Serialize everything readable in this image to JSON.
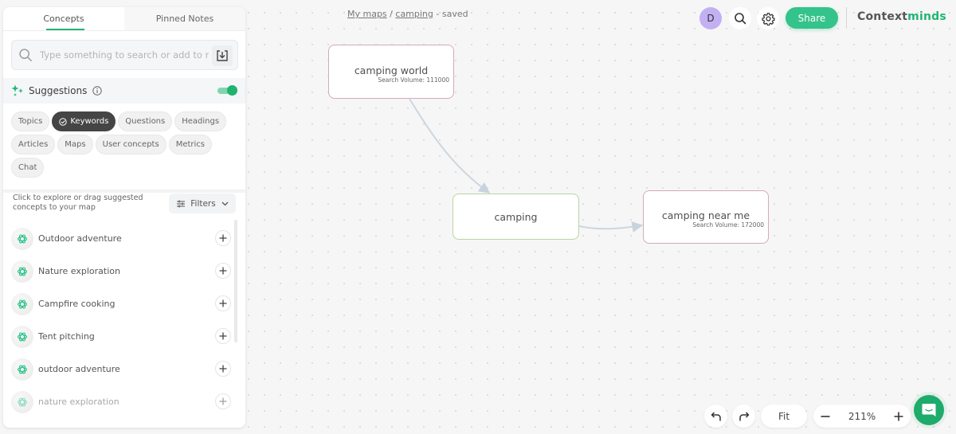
{
  "sidebar": {
    "tabs": [
      {
        "label": "Concepts",
        "active": true
      },
      {
        "label": "Pinned Notes",
        "active": false
      }
    ],
    "search": {
      "placeholder": "Type something to search or add to map",
      "value": ""
    },
    "suggestions": {
      "label": "Suggestions",
      "enabled": true
    },
    "chips": [
      {
        "label": "Topics",
        "active": false
      },
      {
        "label": "Keywords",
        "active": true
      },
      {
        "label": "Questions",
        "active": false
      },
      {
        "label": "Headings",
        "active": false
      },
      {
        "label": "Articles",
        "active": false
      },
      {
        "label": "Maps",
        "active": false
      },
      {
        "label": "User concepts",
        "active": false
      },
      {
        "label": "Metrics",
        "active": false
      },
      {
        "label": "Chat",
        "active": false
      }
    ],
    "hint": "Click to explore or drag suggested concepts to your map",
    "filters_label": "Filters",
    "concepts": [
      {
        "label": "Outdoor adventure"
      },
      {
        "label": "Nature exploration"
      },
      {
        "label": "Campfire cooking"
      },
      {
        "label": "Tent pitching"
      },
      {
        "label": "outdoor adventure"
      },
      {
        "label": "nature exploration"
      }
    ]
  },
  "breadcrumb": {
    "root": "My maps",
    "separator": "/",
    "current": "camping",
    "status": "- saved"
  },
  "header": {
    "avatar_initial": "D",
    "share_label": "Share",
    "brand_primary": "Context",
    "brand_accent": "minds",
    "accent_color": "#22b573"
  },
  "map": {
    "nodes": [
      {
        "id": "cw",
        "title": "camping world",
        "meta": "Search Volume: 111000",
        "kind": "keyword"
      },
      {
        "id": "c",
        "title": "camping",
        "meta": "",
        "kind": "root"
      },
      {
        "id": "cnm",
        "title": "camping near me",
        "meta": "Search Volume: 172000",
        "kind": "keyword"
      }
    ],
    "edges": [
      {
        "from": "camping world",
        "to": "camping"
      },
      {
        "from": "camping",
        "to": "camping near me"
      }
    ]
  },
  "controls": {
    "fit_label": "Fit",
    "zoom_level": "211%"
  }
}
